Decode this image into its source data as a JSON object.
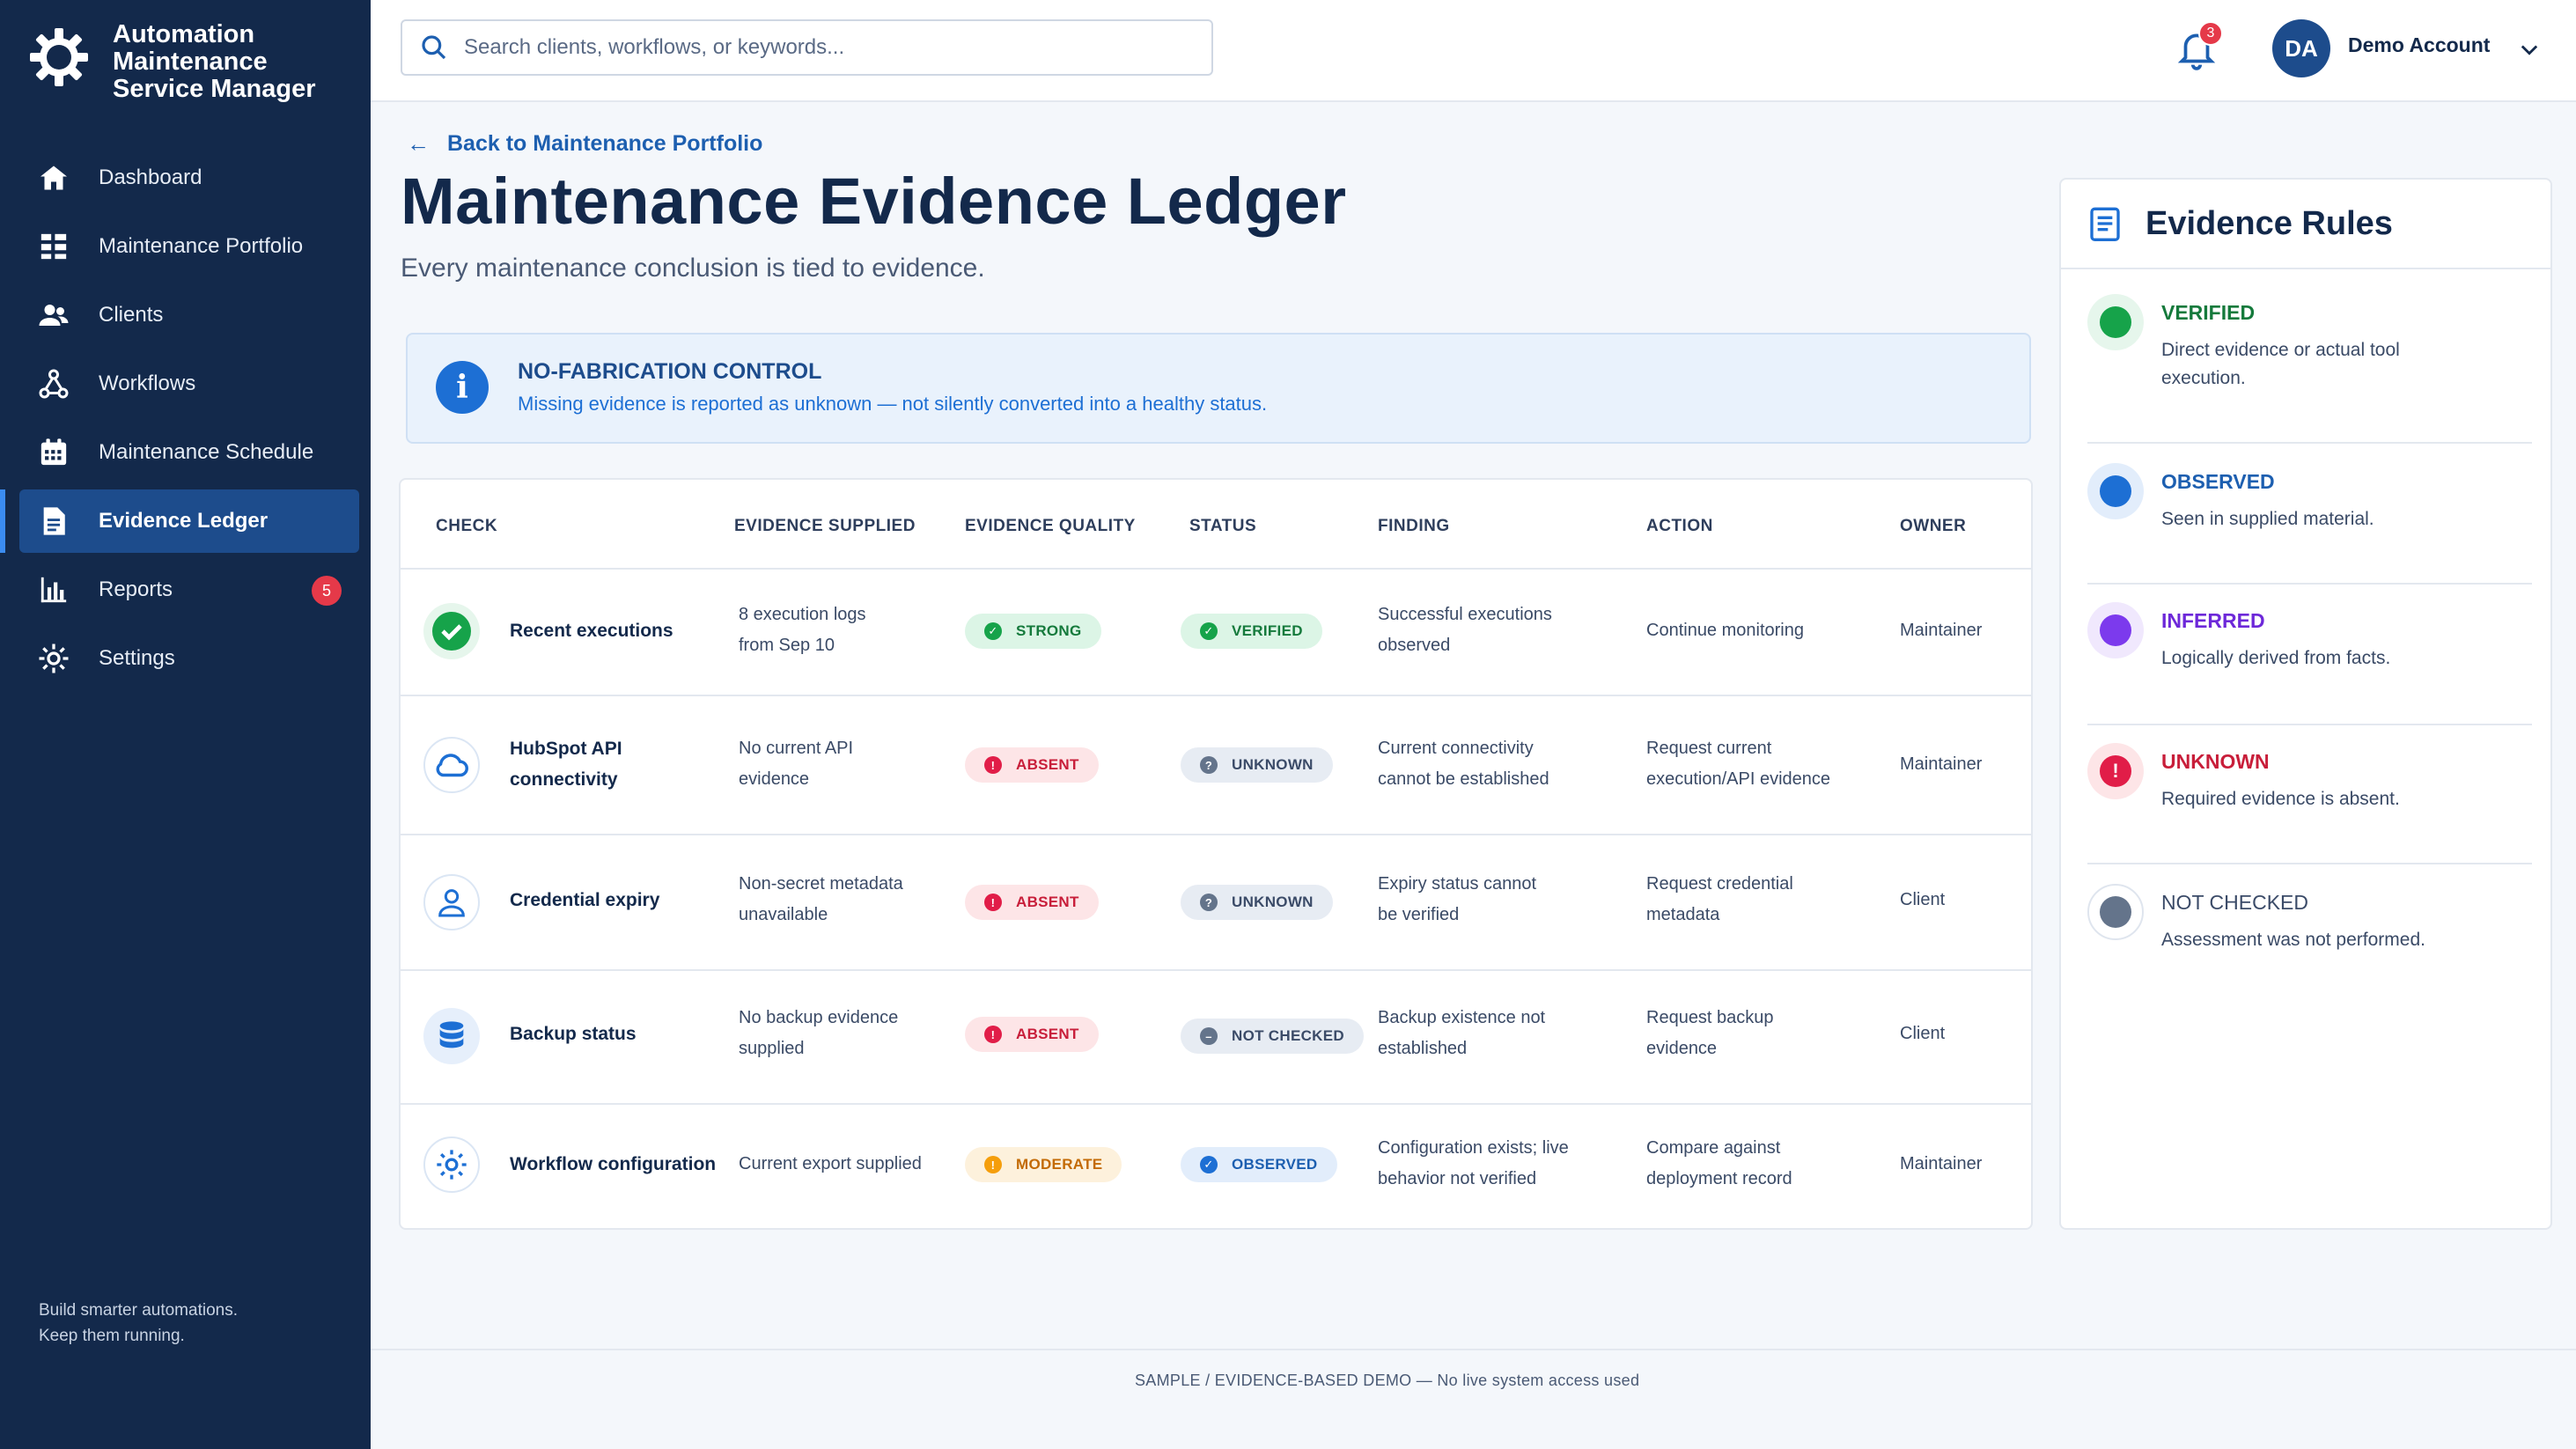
{
  "app": {
    "title": "Automation Maintenance Service Manager"
  },
  "sidebar": {
    "items": [
      {
        "label": "Dashboard",
        "icon": "home-icon"
      },
      {
        "label": "Maintenance Portfolio",
        "icon": "grid-icon"
      },
      {
        "label": "Clients",
        "icon": "users-icon"
      },
      {
        "label": "Workflows",
        "icon": "workflow-icon"
      },
      {
        "label": "Maintenance Schedule",
        "icon": "calendar-icon"
      },
      {
        "label": "Evidence Ledger",
        "icon": "document-icon",
        "active": true
      },
      {
        "label": "Reports",
        "icon": "bar-chart-icon",
        "badge": "5"
      },
      {
        "label": "Settings",
        "icon": "gear-icon"
      }
    ],
    "footer_line1": "Build smarter automations.",
    "footer_line2": "Keep them running."
  },
  "topbar": {
    "search_placeholder": "Search clients, workflows, or keywords...",
    "notification_count": "3",
    "avatar_initials": "DA",
    "account_name": "Demo Account"
  },
  "page": {
    "back_link": "Back to Maintenance Portfolio",
    "title": "Maintenance Evidence Ledger",
    "subtitle": "Every maintenance conclusion is tied to evidence."
  },
  "alert": {
    "title": "NO-FABRICATION CONTROL",
    "text": "Missing evidence is reported as unknown — not silently converted into a healthy status."
  },
  "table": {
    "columns": [
      "CHECK",
      "EVIDENCE SUPPLIED",
      "EVIDENCE QUALITY",
      "STATUS",
      "FINDING",
      "ACTION",
      "OWNER"
    ],
    "rows": [
      {
        "icon": "check-circle-icon",
        "check": "Recent executions",
        "evidence_1": "8 execution logs",
        "evidence_2": "from Sep 10",
        "quality": "STRONG",
        "quality_kind": "strong",
        "status": "VERIFIED",
        "status_kind": "verified",
        "finding_1": "Successful executions",
        "finding_2": "observed",
        "action_1": "Continue monitoring",
        "action_2": "",
        "owner": "Maintainer"
      },
      {
        "icon": "cloud-icon",
        "check": "HubSpot API connectivity",
        "evidence_1": "No current API",
        "evidence_2": "evidence",
        "quality": "ABSENT",
        "quality_kind": "absent",
        "status": "UNKNOWN",
        "status_kind": "unknown",
        "finding_1": "Current connectivity",
        "finding_2": "cannot be established",
        "action_1": "Request current",
        "action_2": "execution/API evidence",
        "owner": "Maintainer"
      },
      {
        "icon": "user-icon",
        "check": "Credential expiry",
        "evidence_1": "Non-secret metadata",
        "evidence_2": "unavailable",
        "quality": "ABSENT",
        "quality_kind": "absent",
        "status": "UNKNOWN",
        "status_kind": "unknown",
        "finding_1": "Expiry status cannot",
        "finding_2": "be verified",
        "action_1": "Request credential",
        "action_2": "metadata",
        "owner": "Client"
      },
      {
        "icon": "database-icon",
        "check": "Backup status",
        "evidence_1": "No backup evidence",
        "evidence_2": "supplied",
        "quality": "ABSENT",
        "quality_kind": "absent",
        "status": "NOT CHECKED",
        "status_kind": "notchecked",
        "finding_1": "Backup existence not",
        "finding_2": "established",
        "action_1": "Request backup",
        "action_2": "evidence",
        "owner": "Client"
      },
      {
        "icon": "gear-icon",
        "check": "Workflow configuration",
        "evidence_1": "Current export supplied",
        "evidence_2": "",
        "quality": "MODERATE",
        "quality_kind": "moderate",
        "status": "OBSERVED",
        "status_kind": "observed",
        "finding_1": "Configuration exists; live",
        "finding_2": "behavior not verified",
        "action_1": "Compare against",
        "action_2": "deployment record",
        "owner": "Maintainer"
      }
    ]
  },
  "rules": {
    "title": "Evidence Rules",
    "items": [
      {
        "name": "VERIFIED",
        "desc": "Direct evidence or actual tool execution.",
        "color": "#16a34a"
      },
      {
        "name": "OBSERVED",
        "desc": "Seen in supplied material.",
        "color": "#1d6fd4"
      },
      {
        "name": "INFERRED",
        "desc": "Logically derived from facts.",
        "color": "#7c3aed"
      },
      {
        "name": "UNKNOWN",
        "desc": "Required evidence is absent.",
        "color": "#e11d48"
      },
      {
        "name": "NOT CHECKED",
        "desc": "Assessment was not performed.",
        "color": "#64748b"
      }
    ]
  },
  "footer": {
    "text": "SAMPLE  /  EVIDENCE-BASED DEMO — No live system access used"
  },
  "colors": {
    "sidebar_bg": "#13294b",
    "active_nav": "#1d4c8c",
    "accent": "#1d6fd4",
    "danger": "#e53949"
  }
}
